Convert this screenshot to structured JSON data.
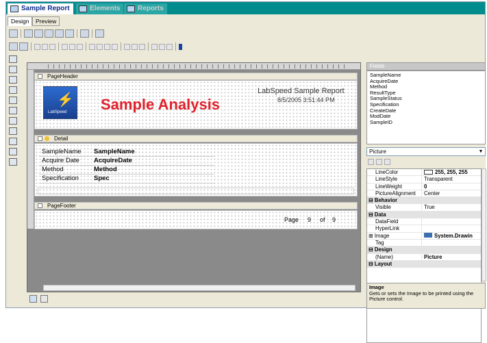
{
  "tabs": [
    {
      "label": "Sample Report",
      "active": true
    },
    {
      "label": "Elements",
      "active": false
    },
    {
      "label": "Reports",
      "active": false
    }
  ],
  "view_tabs": [
    "Design",
    "Preview"
  ],
  "bands": {
    "page_header": "PageHeader",
    "detail": "Detail",
    "page_footer": "PageFooter"
  },
  "header": {
    "logo_caption": "LabSpeed",
    "title": "Sample Analysis",
    "lab_title": "LabSpeed Sample Report",
    "datetime": "8/5/2005 3:51:44 PM"
  },
  "detail_rows": [
    {
      "label": "SampleName",
      "value": "SampleName"
    },
    {
      "label": "Acquire Date",
      "value": "AcquireDate"
    },
    {
      "label": "Method",
      "value": "Method"
    },
    {
      "label": "Specification",
      "value": "Spec"
    }
  ],
  "footer": {
    "page_label": "Page",
    "page": "9",
    "of_label": "of",
    "total": "9"
  },
  "fields_panel": {
    "title": "Fields",
    "items": [
      "SampleName",
      "AcquireDate",
      "Method",
      "ResultType",
      "SampleStatus",
      "Specification",
      "CreateDate",
      "ModDate",
      "SampleID"
    ]
  },
  "selected_object": "Picture",
  "properties": [
    {
      "type": "prop",
      "name": "LineColor",
      "value": "255, 255, 255"
    },
    {
      "type": "prop",
      "name": "LineStyle",
      "value": "Transparent"
    },
    {
      "type": "prop",
      "name": "LineWeight",
      "value": "0"
    },
    {
      "type": "prop",
      "name": "PictureAlignment",
      "value": "Center"
    },
    {
      "type": "cat",
      "name": "Behavior"
    },
    {
      "type": "prop",
      "name": "Visible",
      "value": "True"
    },
    {
      "type": "cat",
      "name": "Data"
    },
    {
      "type": "prop",
      "name": "DataField",
      "value": ""
    },
    {
      "type": "prop",
      "name": "HyperLink",
      "value": ""
    },
    {
      "type": "prop",
      "name": "Image",
      "value": "System.Drawin"
    },
    {
      "type": "prop",
      "name": "Tag",
      "value": ""
    },
    {
      "type": "cat",
      "name": "Design"
    },
    {
      "type": "prop",
      "name": "(Name)",
      "value": "Picture"
    },
    {
      "type": "cat",
      "name": "Layout"
    }
  ],
  "description": {
    "title": "Image",
    "text": "Gets or sets the Image to be printed using the Picture control."
  },
  "colors": {
    "tab_bar": "#008c8c",
    "title_red": "#e0212b",
    "tab_active_text": "#0a2a8a"
  }
}
